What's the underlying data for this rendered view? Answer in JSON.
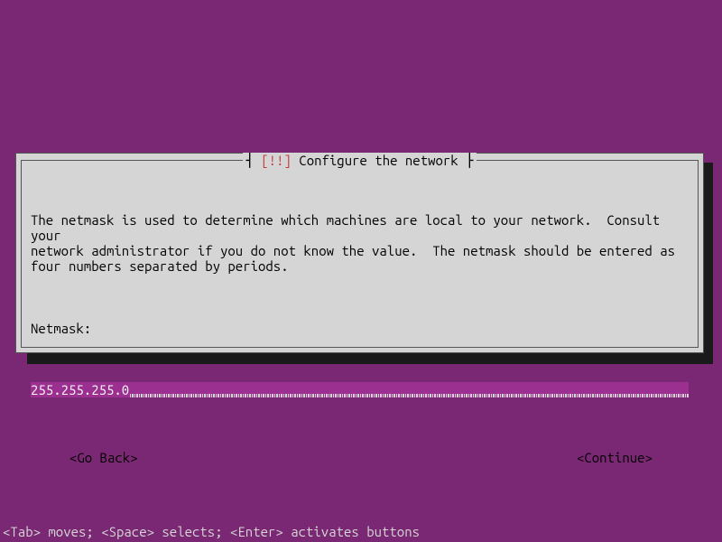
{
  "dialog": {
    "title_prefix": "[!!]",
    "title_text": "Configure the network",
    "description": "The netmask is used to determine which machines are local to your network.  Consult your\nnetwork administrator if you do not know the value.  The netmask should be entered as\nfour numbers separated by periods.",
    "field_label": "Netmask:",
    "input_value": "255.255.255.0",
    "go_back_label": "<Go Back>",
    "continue_label": "<Continue>"
  },
  "footer": {
    "hints": "<Tab> moves; <Space> selects; <Enter> activates buttons"
  }
}
